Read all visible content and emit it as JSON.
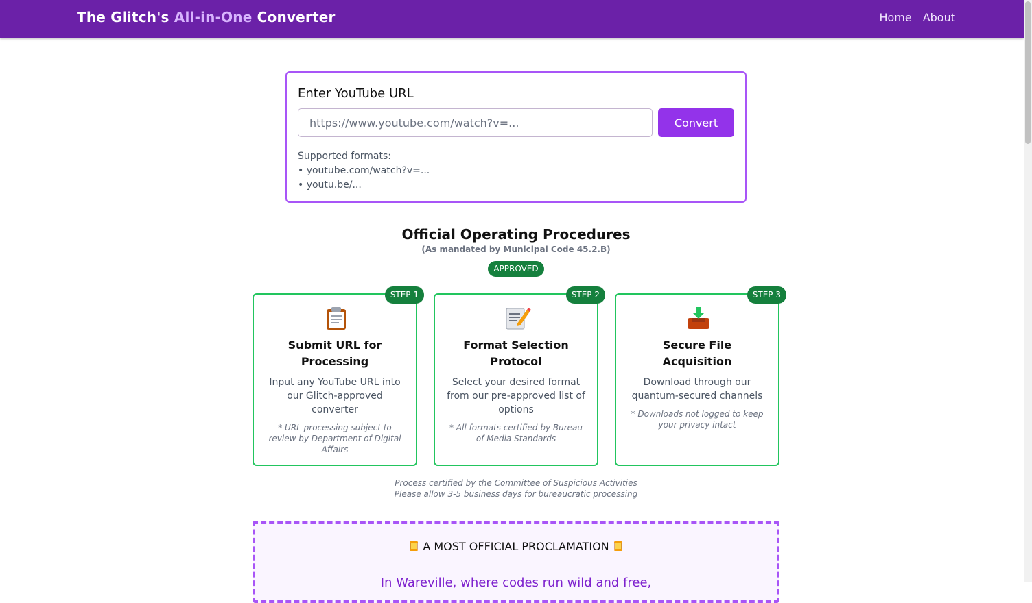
{
  "nav": {
    "brand_prefix": "The Glitch's ",
    "brand_highlight": "All-in-One",
    "brand_suffix": " Converter",
    "links": [
      "Home",
      "About"
    ]
  },
  "url_card": {
    "label": "Enter YouTube URL",
    "input_value": "",
    "input_placeholder": "https://www.youtube.com/watch?v=...",
    "convert_label": "Convert",
    "formats_title": "Supported formats:",
    "formats": [
      "• youtube.com/watch?v=...",
      "• youtu.be/..."
    ]
  },
  "procedures": {
    "title": "Official Operating Procedures",
    "subtitle": "(As mandated by Municipal Code 45.2.B)",
    "badge": "APPROVED",
    "steps": [
      {
        "badge": "STEP 1",
        "icon": "clipboard-icon",
        "title": "Submit URL for Processing",
        "desc": "Input any YouTube URL into our Glitch-approved converter",
        "note": "* URL processing subject to review by Department of Digital Affairs"
      },
      {
        "badge": "STEP 2",
        "icon": "memo-icon",
        "title": "Format Selection Protocol",
        "desc": "Select your desired format from our pre-approved list of options",
        "note": "* All formats certified by Bureau of Media Standards"
      },
      {
        "badge": "STEP 3",
        "icon": "inbox-download-icon",
        "title": "Secure File Acquisition",
        "desc": "Download through our quantum-secured channels",
        "note": "* Downloads not logged to keep your privacy intact"
      }
    ],
    "cert_line1": "Process certified by the Committee of Suspicious Activities",
    "cert_line2": "Please allow 3-5 business days for bureaucratic processing"
  },
  "proclamation": {
    "title": "A MOST OFFICIAL PROCLAMATION",
    "title_icon": "scroll-icon",
    "line1": "In Wareville, where codes run wild and free,"
  },
  "colors": {
    "nav_bg": "#6b21a8",
    "accent": "#9333ea",
    "approved_green": "#15803d",
    "card_border_green": "#22c55e"
  }
}
